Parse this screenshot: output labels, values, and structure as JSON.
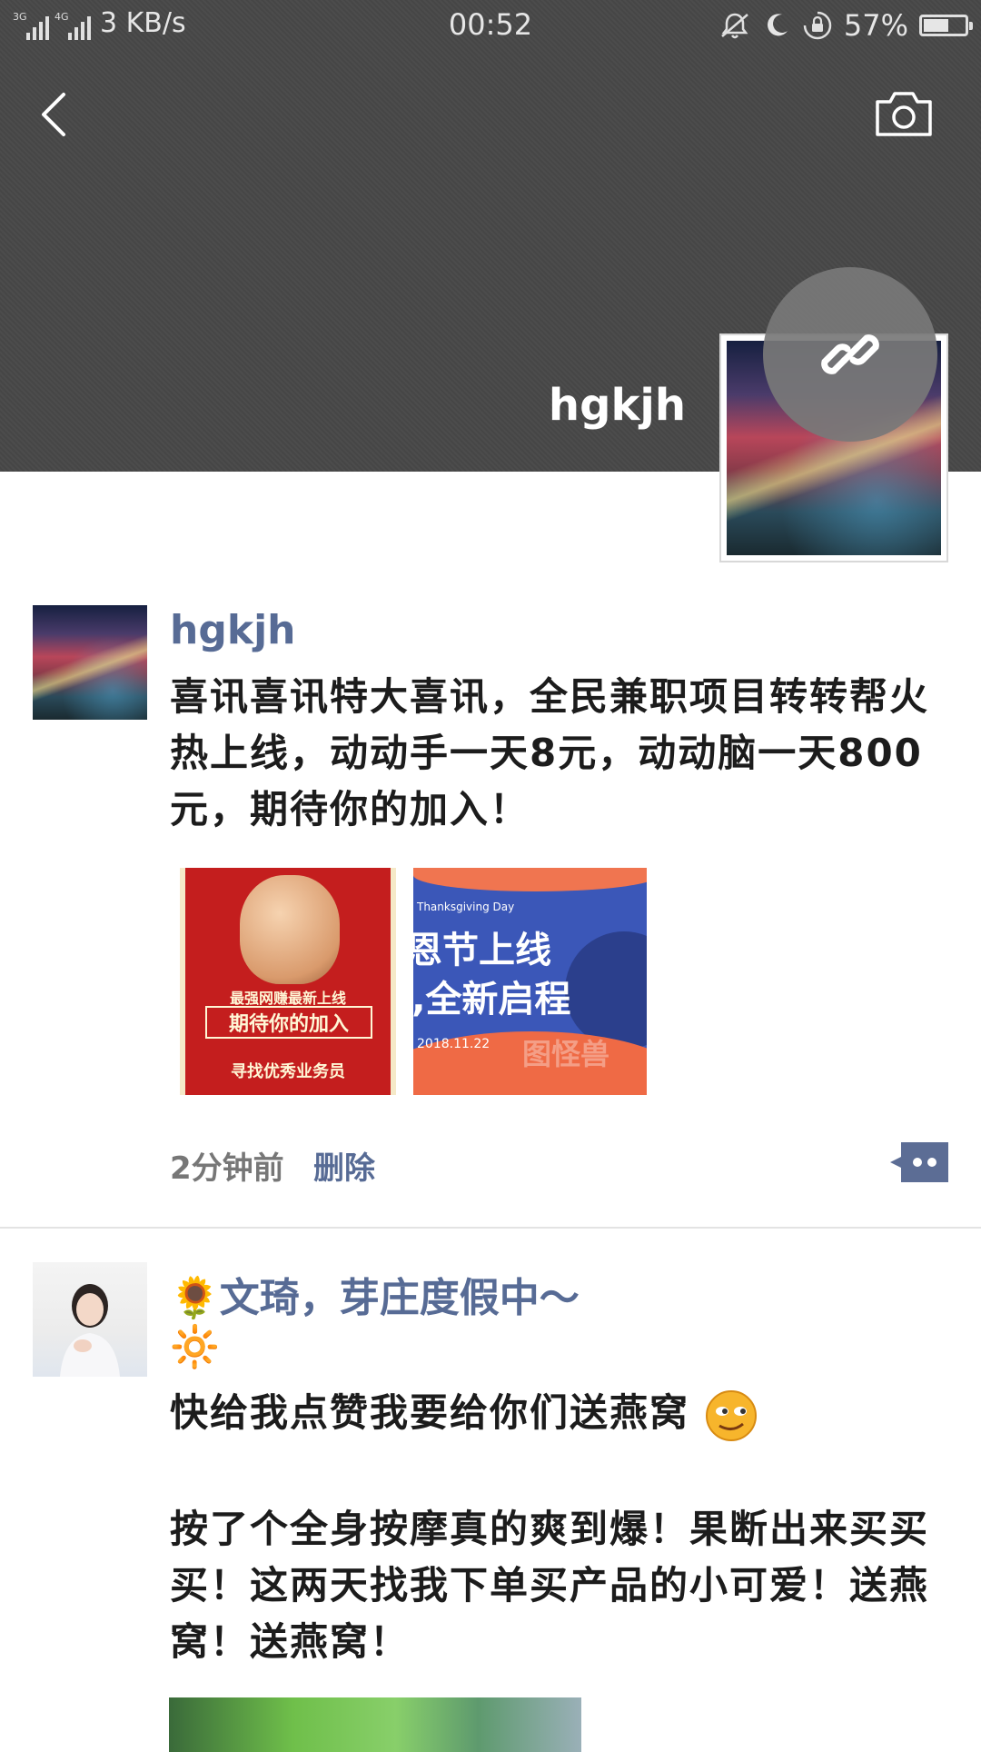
{
  "status_bar": {
    "network_1": "3G",
    "network_2": "4G",
    "speed": "3 KB/s",
    "time": "00:52",
    "battery_percent": "57%",
    "battery_level": 0.57
  },
  "profile": {
    "cover_name": "hgkjh"
  },
  "posts": [
    {
      "author": "hgkjh",
      "text": "喜讯喜讯特大喜讯，全民兼职项目转转帮火热上线，动动手一天8元，动动脑一天800元，期待你的加入！",
      "images": [
        {
          "line1": "最强网赚最新上线",
          "line2": "期待你的加入",
          "line3": "寻找优秀业务员"
        },
        {
          "en": "Thanksgiving Day",
          "line1": "恩节上线",
          "line2": "!,全新启程",
          "date": "2018.11.22",
          "watermark": "图怪兽"
        }
      ],
      "time": "2分钟前",
      "delete_label": "删除"
    },
    {
      "author": "🌻文琦，芽庄度假中～",
      "line1": "🔆",
      "line2": "快给我点赞我要给你们送燕窝",
      "line3": "按了个全身按摩真的爽到爆！果断出来买买买！这两天找我下单买产品的小可爱！送燕窝！送燕窝！"
    }
  ],
  "colors": {
    "link_blue": "#576b95",
    "cover_gray": "#484848"
  }
}
